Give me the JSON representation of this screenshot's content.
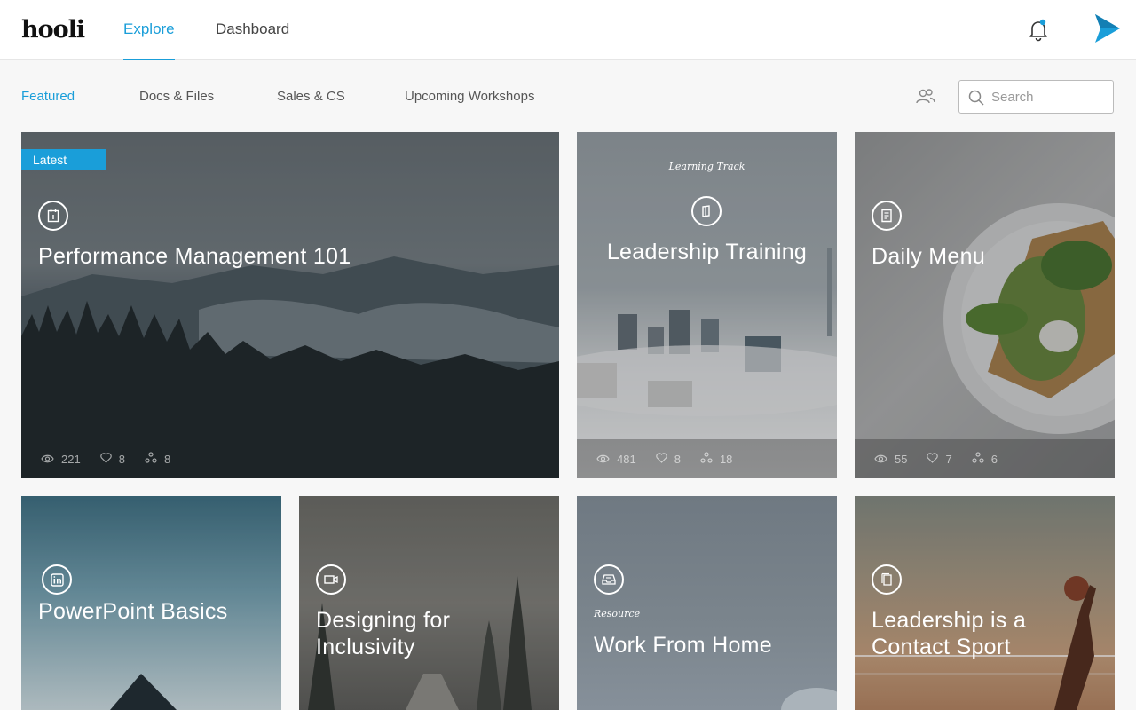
{
  "header": {
    "logo": "hooli",
    "tabs": [
      {
        "label": "Explore",
        "active": true
      },
      {
        "label": "Dashboard",
        "active": false
      }
    ],
    "notification_dot_color": "#1a9ed9"
  },
  "subnav": {
    "items": [
      {
        "label": "Featured",
        "active": true
      },
      {
        "label": "Docs & Files"
      },
      {
        "label": "Sales & CS"
      },
      {
        "label": "Upcoming Workshops"
      }
    ],
    "search_placeholder": "Search"
  },
  "colors": {
    "accent": "#1a9ed9"
  },
  "cards": [
    {
      "title": "Performance Management 101",
      "badge": "Latest",
      "icon": "calendar-icon",
      "views": "221",
      "likes": "8",
      "shares": "8"
    },
    {
      "title": "Leadership Training",
      "kicker": "Learning Track",
      "icon": "book-icon",
      "views": "481",
      "likes": "8",
      "shares": "18"
    },
    {
      "title": "Daily Menu",
      "icon": "document-icon",
      "views": "55",
      "likes": "7",
      "shares": "6"
    },
    {
      "title": "PowerPoint Basics",
      "icon": "linkedin-icon"
    },
    {
      "title_line1": "Designing for",
      "title_line2": "Inclusivity",
      "icon": "video-icon"
    },
    {
      "title": "Work From Home",
      "kicker": "Resource",
      "icon": "inbox-icon"
    },
    {
      "title_line1": "Leadership is a",
      "title_line2": "Contact Sport",
      "icon": "pages-icon"
    }
  ]
}
